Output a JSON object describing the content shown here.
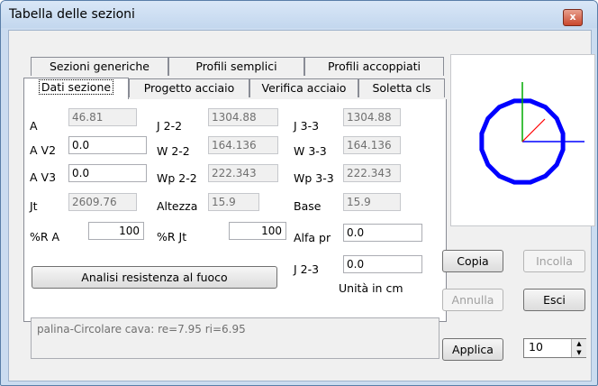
{
  "window": {
    "title": "Tabella delle sezioni",
    "close_glyph": "x"
  },
  "tabs_row1": [
    "Sezioni generiche",
    "Profili semplici",
    "Profili accoppiati"
  ],
  "tabs_row2": [
    "Dati sezione",
    "Progetto acciaio",
    "Verifica acciaio",
    "Soletta cls"
  ],
  "labels": {
    "A": "A",
    "AV2": "A V2",
    "AV3": "A V3",
    "Jt": "Jt",
    "RA": "%R A",
    "J22": "J 2-2",
    "W22": "W 2-2",
    "Wp22": "Wp 2-2",
    "Altezza": "Altezza",
    "RJt": "%R Jt",
    "J33": "J 3-3",
    "W33": "W 3-3",
    "Wp33": "Wp 3-3",
    "Base": "Base",
    "AlfaPr": "Alfa pr",
    "J23": "J 2-3",
    "units": "Unità in cm"
  },
  "values": {
    "A": "46.81",
    "AV2": "0.0",
    "AV3": "0.0",
    "Jt": "2609.76",
    "RA": "100",
    "J22": "1304.88",
    "W22": "164.136",
    "Wp22": "222.343",
    "Altezza": "15.9",
    "RJt": "100",
    "J33": "1304.88",
    "W33": "164.136",
    "Wp33": "222.343",
    "Base": "15.9",
    "AlfaPr": "0.0",
    "J23": "0.0"
  },
  "buttons": {
    "fire": "Analisi resistenza al fuoco",
    "copy": "Copia",
    "paste": "Incolla",
    "undo": "Annulla",
    "exit": "Esci",
    "apply": "Applica"
  },
  "info_text": "palina-Circolare  cava: re=7.95  ri=6.95",
  "spinner_value": "10",
  "colors": {
    "section_outline": "#0000ff",
    "axis_2": "#00aa00",
    "axis_3": "#0000ff",
    "axis_diag": "#ff0000"
  }
}
